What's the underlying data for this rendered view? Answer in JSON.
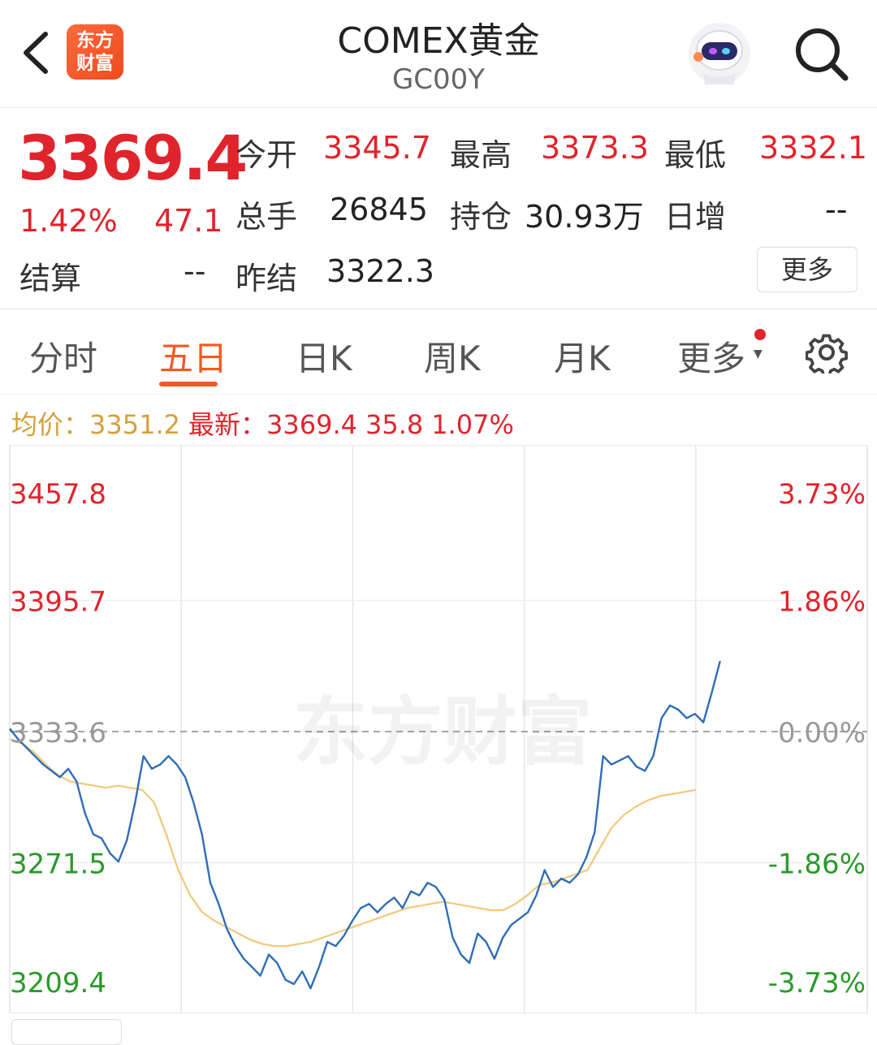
{
  "header": {
    "title": "COMEX黄金",
    "subtitle": "GC00Y",
    "logo_text_line1": "东方",
    "logo_text_line2": "财富"
  },
  "quote": {
    "price": "3369.4",
    "change_pct": "1.42%",
    "change": "47.1",
    "settle_label": "结算",
    "settle_value": "--",
    "open_label": "今开",
    "open_value": "3345.7",
    "high_label": "最高",
    "high_value": "3373.3",
    "low_label": "最低",
    "low_value": "3332.1",
    "volume_label": "总手",
    "volume_value": "26845",
    "oi_label": "持仓",
    "oi_value": "30.93万",
    "daily_inc_label": "日增",
    "daily_inc_value": "--",
    "prev_settle_label": "昨结",
    "prev_settle_value": "3322.3",
    "more_label": "更多"
  },
  "tabs": [
    {
      "label": "分时",
      "active": false
    },
    {
      "label": "五日",
      "active": true
    },
    {
      "label": "日K",
      "active": false
    },
    {
      "label": "周K",
      "active": false
    },
    {
      "label": "月K",
      "active": false
    },
    {
      "label": "更多",
      "active": false
    }
  ],
  "info": {
    "avg_label": "均价：",
    "avg_value": "3351.2",
    "latest_label": "最新：",
    "latest_value": "3369.4",
    "latest_change": "35.8",
    "latest_pct": "1.07%"
  },
  "colors": {
    "up": "#e0242c",
    "down": "#2a9a2a",
    "price_line": "#2f6db7",
    "avg_line": "#f2c87a",
    "accent": "#f05a24"
  },
  "chart_data": {
    "type": "line",
    "watermark": "东方财富",
    "ylim": [
      3209.4,
      3457.8
    ],
    "reference": 3333.6,
    "y_ticks_left": [
      "3457.8",
      "3395.7",
      "3333.6",
      "3271.5",
      "3209.4"
    ],
    "y_ticks_right": [
      "3.73%",
      "1.86%",
      "0.00%",
      "-1.86%",
      "-3.73%"
    ],
    "days": 5,
    "series": [
      {
        "key": "price",
        "values": [
          3335,
          3330,
          3326,
          3322,
          3318,
          3315,
          3312,
          3316,
          3310,
          3295,
          3285,
          3283,
          3276,
          3272,
          3282,
          3300,
          3322,
          3316,
          3318,
          3322,
          3318,
          3312,
          3300,
          3285,
          3262,
          3252,
          3240,
          3232,
          3226,
          3222,
          3218,
          3228,
          3224,
          3216,
          3214,
          3220,
          3212,
          3222,
          3234,
          3232,
          3237,
          3244,
          3250,
          3252,
          3248,
          3252,
          3255,
          3250,
          3258,
          3256,
          3262,
          3260,
          3254,
          3236,
          3228,
          3224,
          3238,
          3234,
          3226,
          3236,
          3242,
          3245,
          3248,
          3256,
          3268,
          3260,
          3264,
          3262,
          3266,
          3274,
          3286,
          3322,
          3318,
          3320,
          3322,
          3317,
          3315,
          3322,
          3340,
          3346,
          3344,
          3340,
          3342,
          3338,
          3352,
          3367
        ]
      },
      {
        "key": "average",
        "values": [
          3330,
          3328,
          3324,
          3318,
          3313,
          3310,
          3309,
          3308,
          3307,
          3308,
          3307,
          3306,
          3300,
          3285,
          3268,
          3256,
          3248,
          3244,
          3241,
          3238,
          3235,
          3233,
          3232,
          3232,
          3233,
          3234,
          3236,
          3238,
          3240,
          3242,
          3244,
          3246,
          3248,
          3250,
          3251,
          3252,
          3253,
          3252,
          3251,
          3250,
          3249,
          3249,
          3252,
          3256,
          3261,
          3262,
          3264,
          3266,
          3268,
          3278,
          3288,
          3294,
          3298,
          3301,
          3303,
          3304,
          3305,
          3306
        ]
      }
    ]
  },
  "icons": {
    "back": "chevron-left-icon",
    "search": "search-icon",
    "settings": "gear-icon",
    "avatar": "robot-avatar-icon"
  }
}
